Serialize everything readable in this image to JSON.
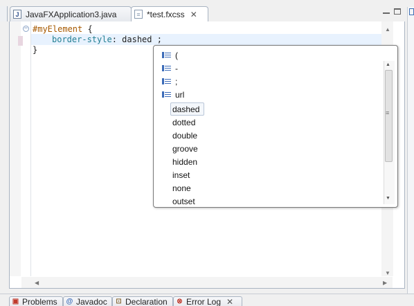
{
  "editor_tabs": [
    {
      "label": "JavaFXApplication3.java",
      "icon": "java-file-icon",
      "active": false
    },
    {
      "label": "*test.fxcss",
      "icon": "css-file-icon",
      "active": true
    }
  ],
  "code": {
    "line1": {
      "selector": "#myElement",
      "brace": " {"
    },
    "line2": {
      "property": "border-style",
      "colon": ": ",
      "value": "dashed",
      "semicolon": " ;"
    },
    "line3": {
      "brace": "}"
    }
  },
  "content_assist": {
    "items": [
      {
        "label": "(",
        "icon": "template-icon"
      },
      {
        "label": "-",
        "icon": "template-icon"
      },
      {
        "label": ";",
        "icon": "template-icon"
      },
      {
        "label": "url",
        "icon": "template-icon"
      },
      {
        "label": "dashed",
        "icon": ""
      },
      {
        "label": "dotted",
        "icon": ""
      },
      {
        "label": "double",
        "icon": ""
      },
      {
        "label": "groove",
        "icon": ""
      },
      {
        "label": "hidden",
        "icon": ""
      },
      {
        "label": "inset",
        "icon": ""
      },
      {
        "label": "none",
        "icon": ""
      },
      {
        "label": "outset",
        "icon": ""
      }
    ],
    "selected": "dashed"
  },
  "bottom_tabs": [
    {
      "label": "Problems",
      "icon": "problems-icon"
    },
    {
      "label": "Javadoc",
      "icon": "javadoc-icon"
    },
    {
      "label": "Declaration",
      "icon": "declaration-icon"
    },
    {
      "label": "Error Log",
      "icon": "error-log-icon"
    }
  ],
  "colors": {
    "selector": "#a65900",
    "property": "#237f93",
    "current_line": "#e8f2fe",
    "accent": "#3b6bb8"
  }
}
